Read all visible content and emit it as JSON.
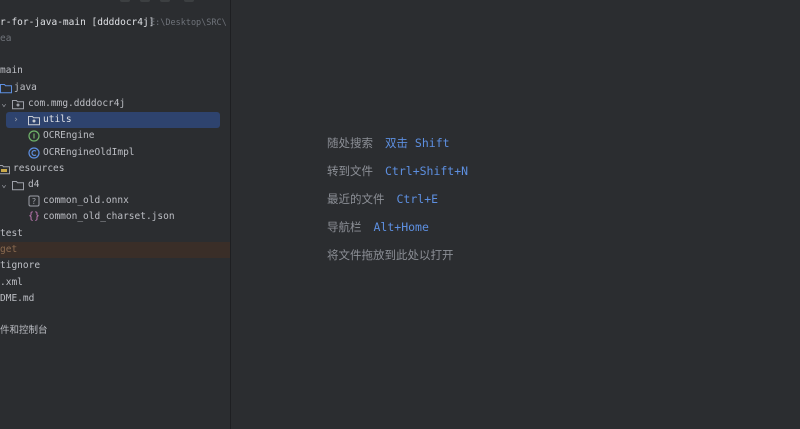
{
  "project": {
    "title": "r-for-java-main [ddddocr4j]",
    "path": "E:\\Desktop\\SRC\\",
    "idea_label": "ea"
  },
  "tree": {
    "main": "main",
    "java": "java",
    "package": "com.mmg.ddddocr4j",
    "utils": "utils",
    "ocr_engine": "OCREngine",
    "ocr_engine_old": "OCREngineOldImpl",
    "resources": "resources",
    "d4": "d4",
    "onnx_file": "common_old.onnx",
    "charset_file": "common_old_charset.json",
    "test": "test",
    "target": "get",
    "gitignore": "tignore",
    "pom": ".xml",
    "readme": "DME.md",
    "scratches": "件和控制台"
  },
  "hints": [
    {
      "label": "随处搜索",
      "key": "双击 Shift"
    },
    {
      "label": "转到文件",
      "key": "Ctrl+Shift+N"
    },
    {
      "label": "最近的文件",
      "key": "Ctrl+E"
    },
    {
      "label": "导航栏",
      "key": "Alt+Home"
    },
    {
      "label": "将文件拖放到此处以打开",
      "key": ""
    }
  ],
  "colors": {
    "sidebar_bg": "#2b2d30",
    "selection": "#2e436e",
    "accent_key": "#5d8fe0",
    "excluded_bg": "#3a2e28"
  },
  "icons": {
    "folder": "folder-icon",
    "package": "package-icon",
    "interface": "interface-icon",
    "class": "class-icon",
    "unknown_file": "unknown-file-icon",
    "json": "json-file-icon",
    "resources": "resources-folder-icon"
  }
}
